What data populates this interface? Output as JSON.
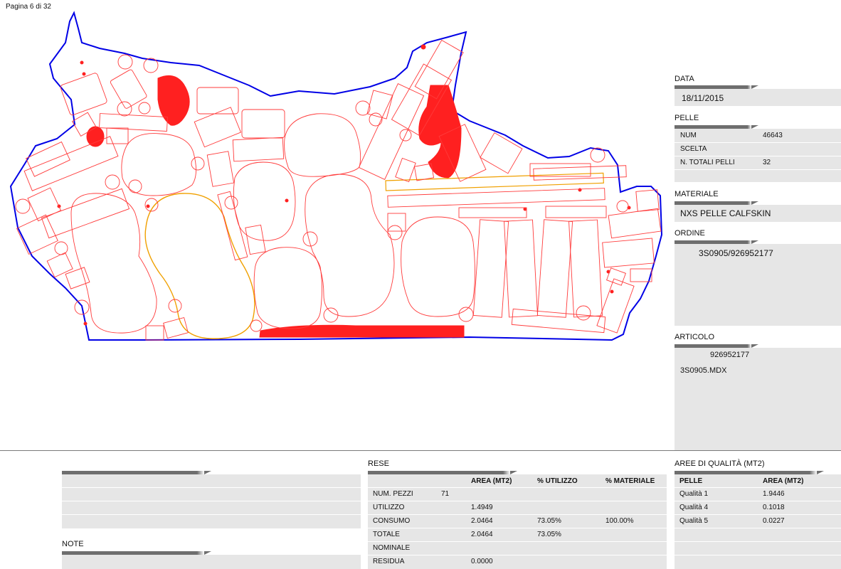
{
  "page_label": "Pagina 6 di 32",
  "colors": {
    "outline": "#0000e6",
    "piece": "#ff3b3b",
    "defect": "#ff2020",
    "selected": "#f0a000",
    "panel": "#e6e6e6",
    "header_bar": "#6e6e6e"
  },
  "data": {
    "label": "DATA",
    "value": "18/11/2015"
  },
  "pelle": {
    "label": "PELLE",
    "rows": [
      {
        "key": "NUM",
        "value": "46643"
      },
      {
        "key": "SCELTA",
        "value": ""
      },
      {
        "key": "N. TOTALI PELLI",
        "value": "32"
      }
    ]
  },
  "materiale": {
    "label": "MATERIALE",
    "value": "NXS PELLE CALFSKIN"
  },
  "ordine": {
    "label": "ORDINE",
    "value": "3S0905/926952177"
  },
  "articolo": {
    "label": "ARTICOLO",
    "code": "926952177",
    "file": "3S0905.MDX"
  },
  "note": {
    "label": "NOTE"
  },
  "rese": {
    "label": "RESE",
    "headers": [
      "",
      "",
      "AREA (MT2)",
      "% UTILIZZO",
      "% MATERIALE"
    ],
    "rows": [
      {
        "name": "NUM. PEZZI",
        "count": "71",
        "area": "",
        "utilizzo": "",
        "materiale": ""
      },
      {
        "name": "UTILIZZO",
        "count": "",
        "area": "1.4949",
        "utilizzo": "",
        "materiale": ""
      },
      {
        "name": "CONSUMO",
        "count": "",
        "area": "2.0464",
        "utilizzo": "73.05%",
        "materiale": "100.00%"
      },
      {
        "name": "TOTALE",
        "count": "",
        "area": "2.0464",
        "utilizzo": "73.05%",
        "materiale": ""
      },
      {
        "name": "NOMINALE",
        "count": "",
        "area": "",
        "utilizzo": "",
        "materiale": ""
      },
      {
        "name": "RESIDUA",
        "count": "",
        "area": "0.0000",
        "utilizzo": "",
        "materiale": ""
      }
    ]
  },
  "aree": {
    "label": "AREE DI QUALITÀ (MT2)",
    "headers": [
      "PELLE",
      "AREA (MT2)"
    ],
    "rows": [
      {
        "name": "Qualità 1",
        "area": "1.9446"
      },
      {
        "name": "Qualità 4",
        "area": "0.1018"
      },
      {
        "name": "Qualità 5",
        "area": "0.0227"
      }
    ]
  }
}
